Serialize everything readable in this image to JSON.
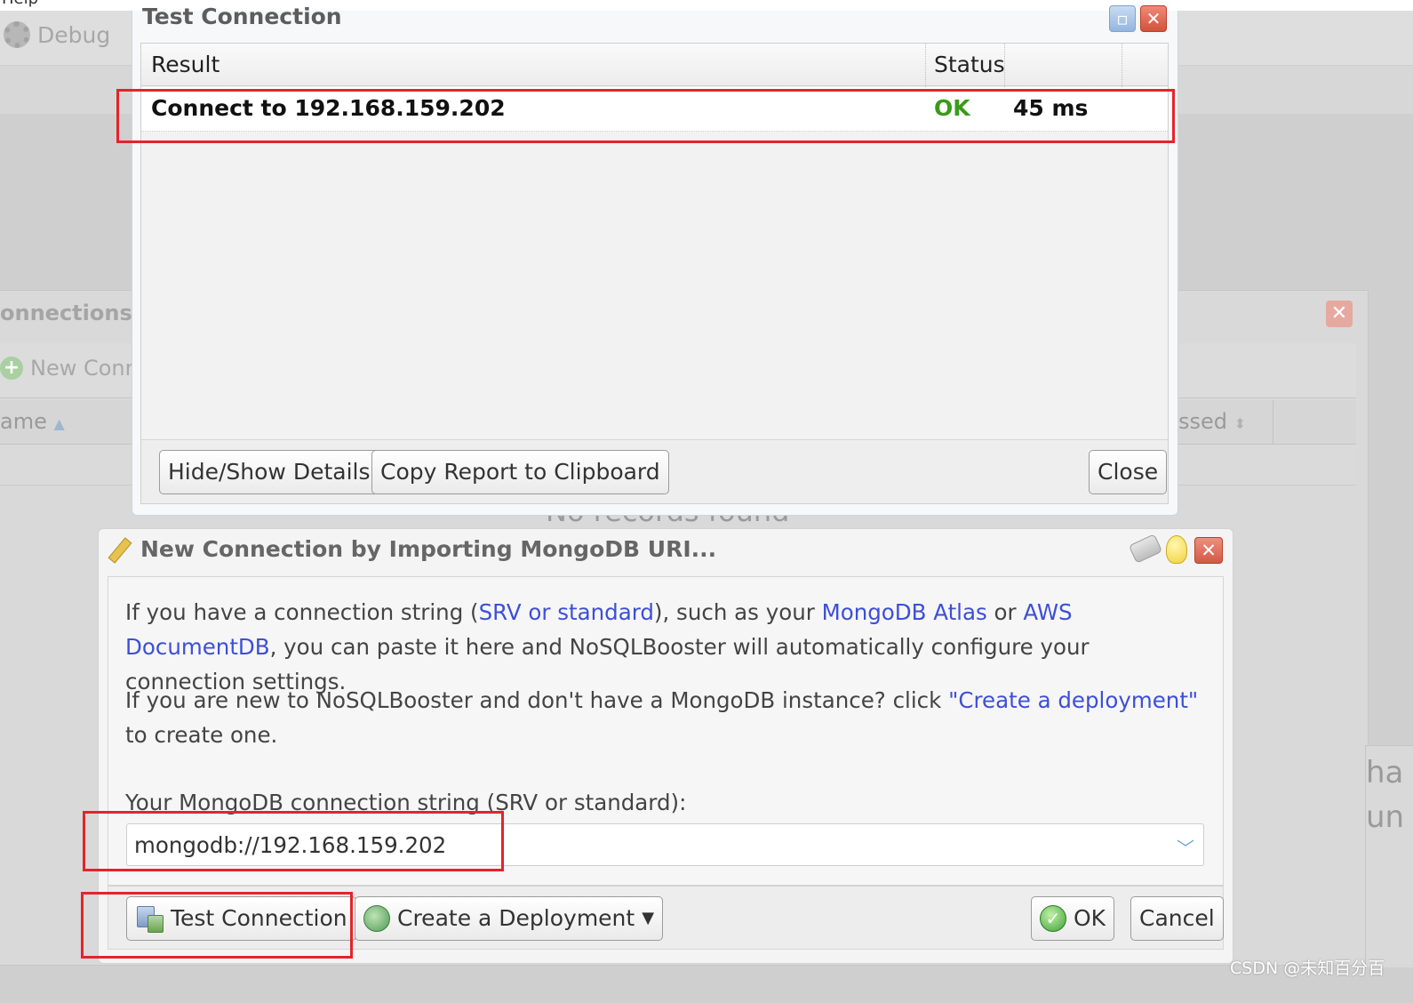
{
  "background": {
    "menu_text": "Help",
    "debug_label": "Debug",
    "connections_title": "onnections",
    "new_connection_label": "New Conn",
    "col_name": "ame",
    "col_accessed": "ssed",
    "no_records": "No records found",
    "side_text_1": "ha",
    "side_text_2": "un"
  },
  "test_dialog": {
    "title": "Test Connection",
    "columns": {
      "result": "Result",
      "status": "Status"
    },
    "row": {
      "result": "Connect to 192.168.159.202",
      "status": "OK",
      "time": "45 ms"
    },
    "buttons": {
      "details": "Hide/Show Details",
      "copy": "Copy Report to Clipboard",
      "close": "Close"
    }
  },
  "uri_dialog": {
    "title": "New Connection by Importing MongoDB URI...",
    "para1": {
      "t1": "If you have a connection string (",
      "link1": "SRV or standard",
      "t2": "), such as your ",
      "link2": "MongoDB Atlas",
      "t3": " or ",
      "link3": "AWS DocumentDB",
      "t4": ", you can paste it here and NoSQLBooster will automatically configure your connection settings."
    },
    "para2": {
      "t1": "If you are new to NoSQLBooster and don't have a MongoDB instance? click ",
      "link1": "\"Create a deployment\"",
      "t2": " to create one."
    },
    "field_label": "Your MongoDB connection string (SRV or standard):",
    "connection_string": "mongodb://192.168.159.202",
    "buttons": {
      "test": "Test Connection",
      "deploy": "Create a Deployment",
      "ok": "OK",
      "cancel": "Cancel"
    }
  },
  "watermark": "CSDN @未知百分百",
  "colors": {
    "link": "#3d4fd8",
    "status_ok": "#3a9a1a",
    "highlight": "#e3242b"
  },
  "icons": [
    "gear-icon",
    "plus-icon",
    "maximize-icon",
    "close-icon",
    "pencil-icon",
    "eraser-icon",
    "lightbulb-icon",
    "chevron-down-icon",
    "test-connection-icon",
    "deployment-icon",
    "ok-check-icon",
    "caret-down-icon"
  ]
}
